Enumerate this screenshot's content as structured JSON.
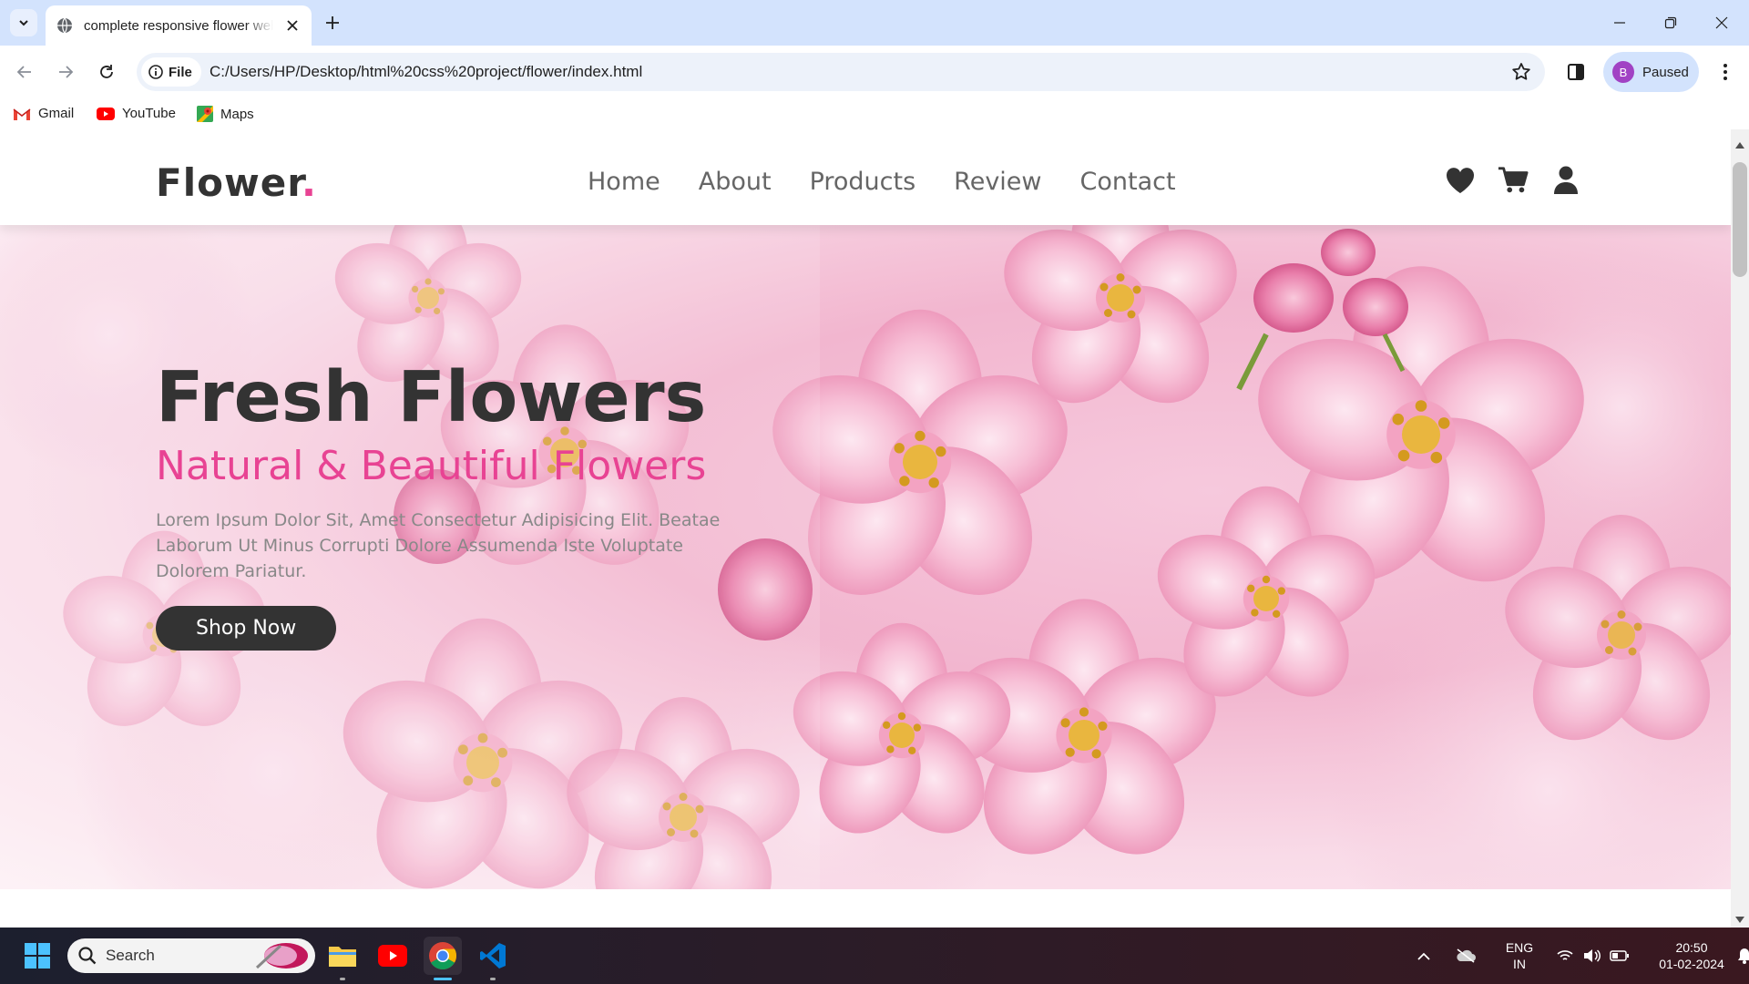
{
  "browser": {
    "tab_title": "complete responsive flower website",
    "security_chip": "File",
    "url": "C:/Users/HP/Desktop/html%20css%20project/flower/index.html",
    "profile_initial": "B",
    "profile_status": "Paused",
    "bookmarks": [
      {
        "label": "Gmail",
        "icon": "gmail-icon"
      },
      {
        "label": "YouTube",
        "icon": "youtube-icon"
      },
      {
        "label": "Maps",
        "icon": "maps-icon"
      }
    ]
  },
  "site": {
    "logo": "Flower",
    "logo_dot": ".",
    "nav": [
      "Home",
      "About",
      "Products",
      "Review",
      "Contact"
    ],
    "header_icons": [
      "heart-icon",
      "cart-icon",
      "user-icon"
    ],
    "hero": {
      "title": "Fresh Flowers",
      "subtitle": "Natural & Beautiful Flowers",
      "text": "Lorem Ipsum Dolor Sit, Amet Consectetur Adipisicing Elit. Beatae Laborum Ut Minus Corrupti Dolore Assumenda Iste Voluptate Dolorem Pariatur.",
      "button": "Shop Now"
    }
  },
  "taskbar": {
    "search_placeholder": "Search",
    "language": "ENG",
    "region": "IN",
    "time": "20:50",
    "date": "01-02-2024"
  },
  "colors": {
    "accent": "#e84393",
    "dark": "#333333",
    "chrome_tabbar": "#d3e3fd"
  }
}
